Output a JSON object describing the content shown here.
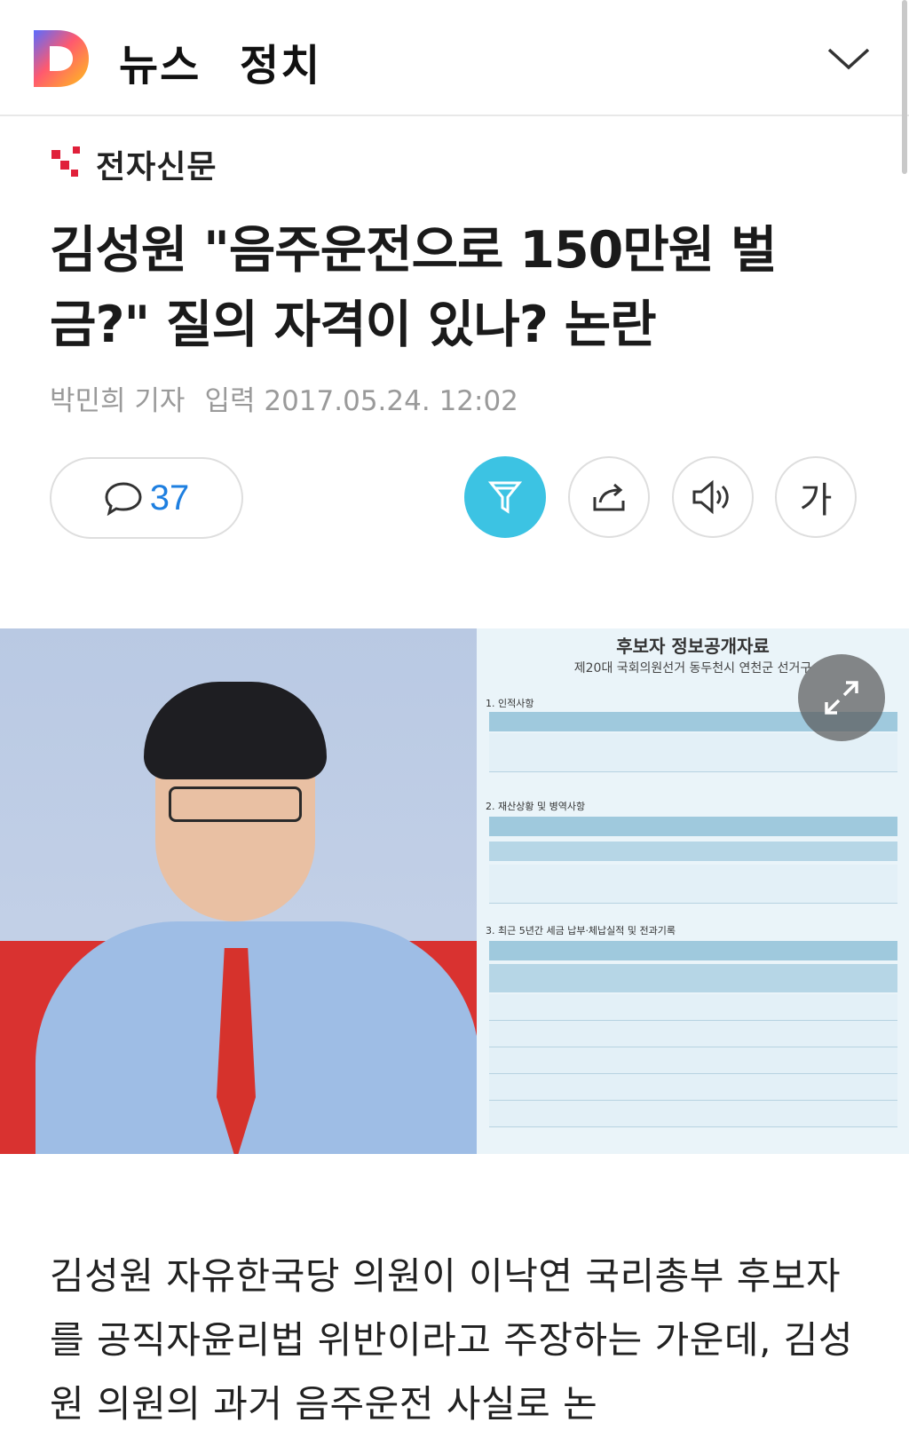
{
  "header": {
    "app_title": "뉴스",
    "section": "정치",
    "logo_icon": "daum-logo-icon",
    "menu_icon": "chevron-down-icon"
  },
  "press": {
    "name": "전자신문",
    "logo_icon": "etnews-logo-icon"
  },
  "article": {
    "headline": "김성원 \"음주운전으로 150만원 벌금?\" 질의 자격이 있나? 논란",
    "reporter": "박민희 기자",
    "date_label": "입력 2017.05.24. 12:02",
    "body": "김성원 자유한국당 의원이 이낙연 국리총부 후보자를 공직자윤리법 위반이라고 주장하는 가운데, 김성원 의원의 과거 음주운전 사실로 논"
  },
  "actions": {
    "comment_count": "37",
    "font_button_label": "가",
    "icons": [
      "comment-icon",
      "filter-icon",
      "share-icon",
      "speaker-icon",
      "font-size-icon",
      "expand-icon"
    ]
  },
  "figure": {
    "doc_title": "후보자 정보공개자료",
    "doc_subtitle": "제20대 국회의원선거 동두천시 연천군 선거구",
    "sections": [
      "1. 인적사항",
      "2. 재산상황 및 병역사항",
      "3. 최근 5년간 세금 납부·체납실적 및 전과기록"
    ],
    "colors": {
      "accent": "#3cc3e3",
      "comment_count": "#1e7fe0"
    }
  }
}
